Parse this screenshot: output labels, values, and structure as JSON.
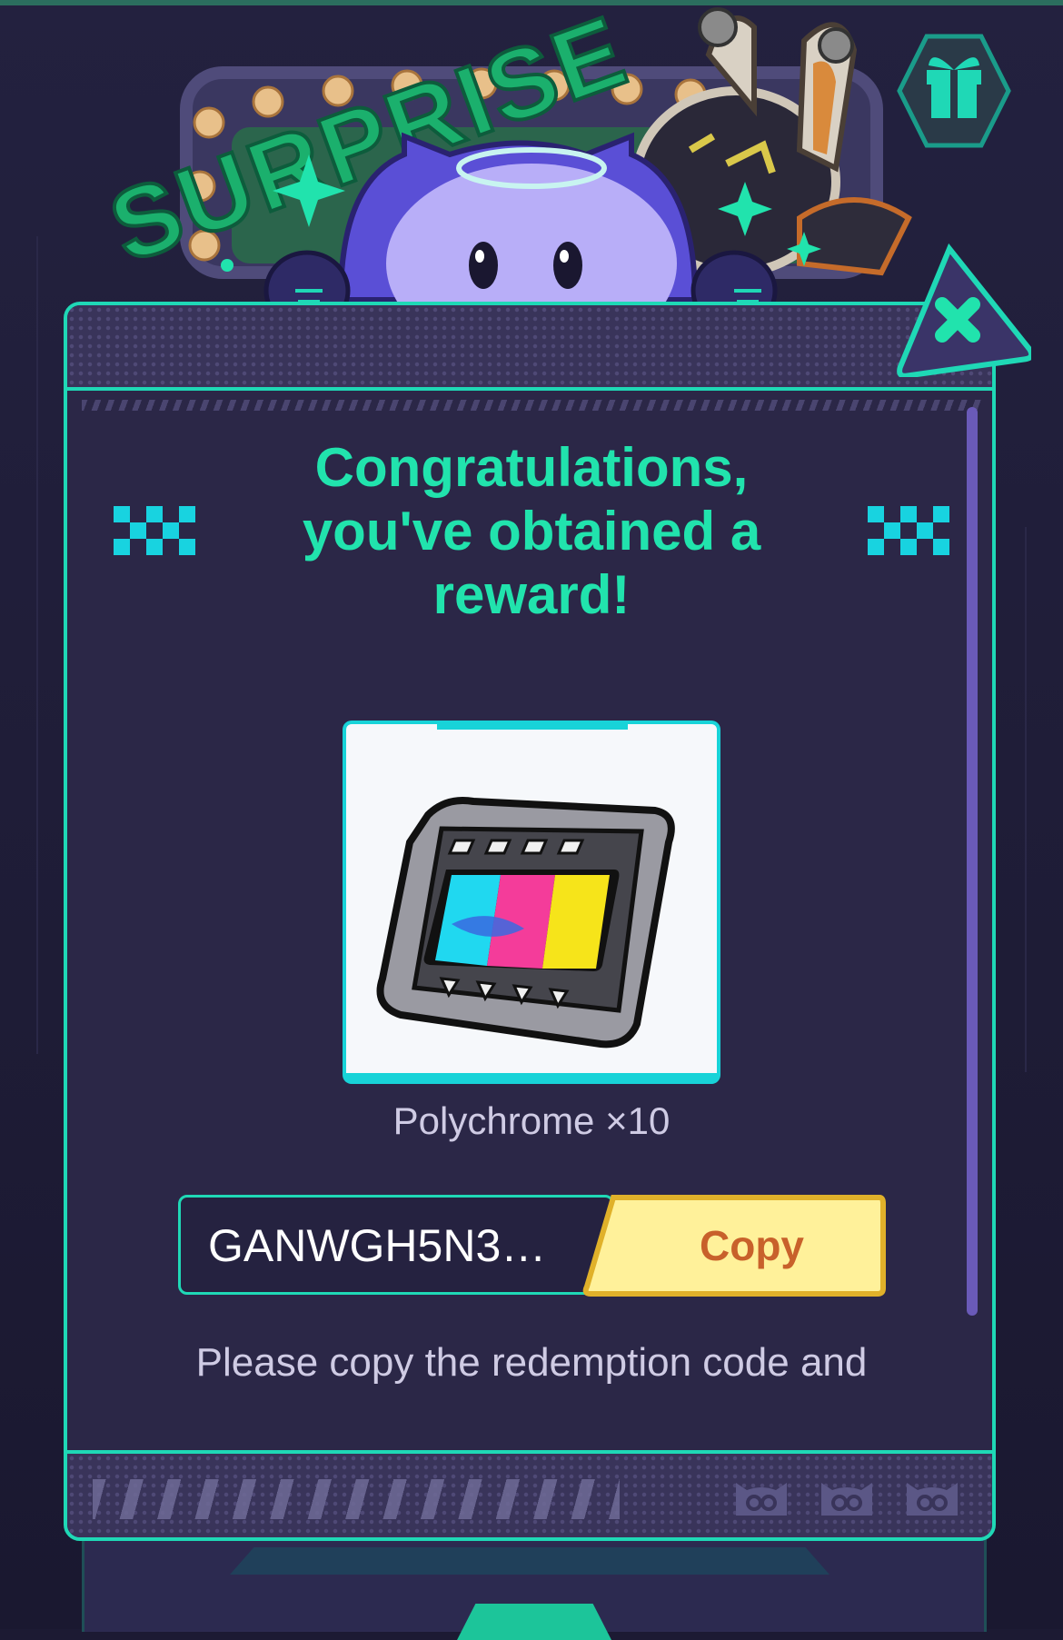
{
  "header_art": {
    "banner_text": "SURPRISE"
  },
  "dialog": {
    "title": "Congratulations, you've obtained a reward!",
    "reward": {
      "icon": "polychrome-film-icon",
      "name": "Polychrome ×10"
    },
    "code_field": {
      "value": "GANWGH5N3…"
    },
    "copy_button": {
      "label": "Copy"
    },
    "instructions": "Please copy the redemption code and"
  },
  "icons": {
    "gift": "gift-icon",
    "close": "close-icon"
  },
  "colors": {
    "accent": "#1fd8b6",
    "title": "#21e3ad",
    "card_border": "#18d3d8",
    "copy_bg": "#fff19a",
    "copy_text": "#c8612b",
    "scrollbar": "#6a5ab8"
  }
}
